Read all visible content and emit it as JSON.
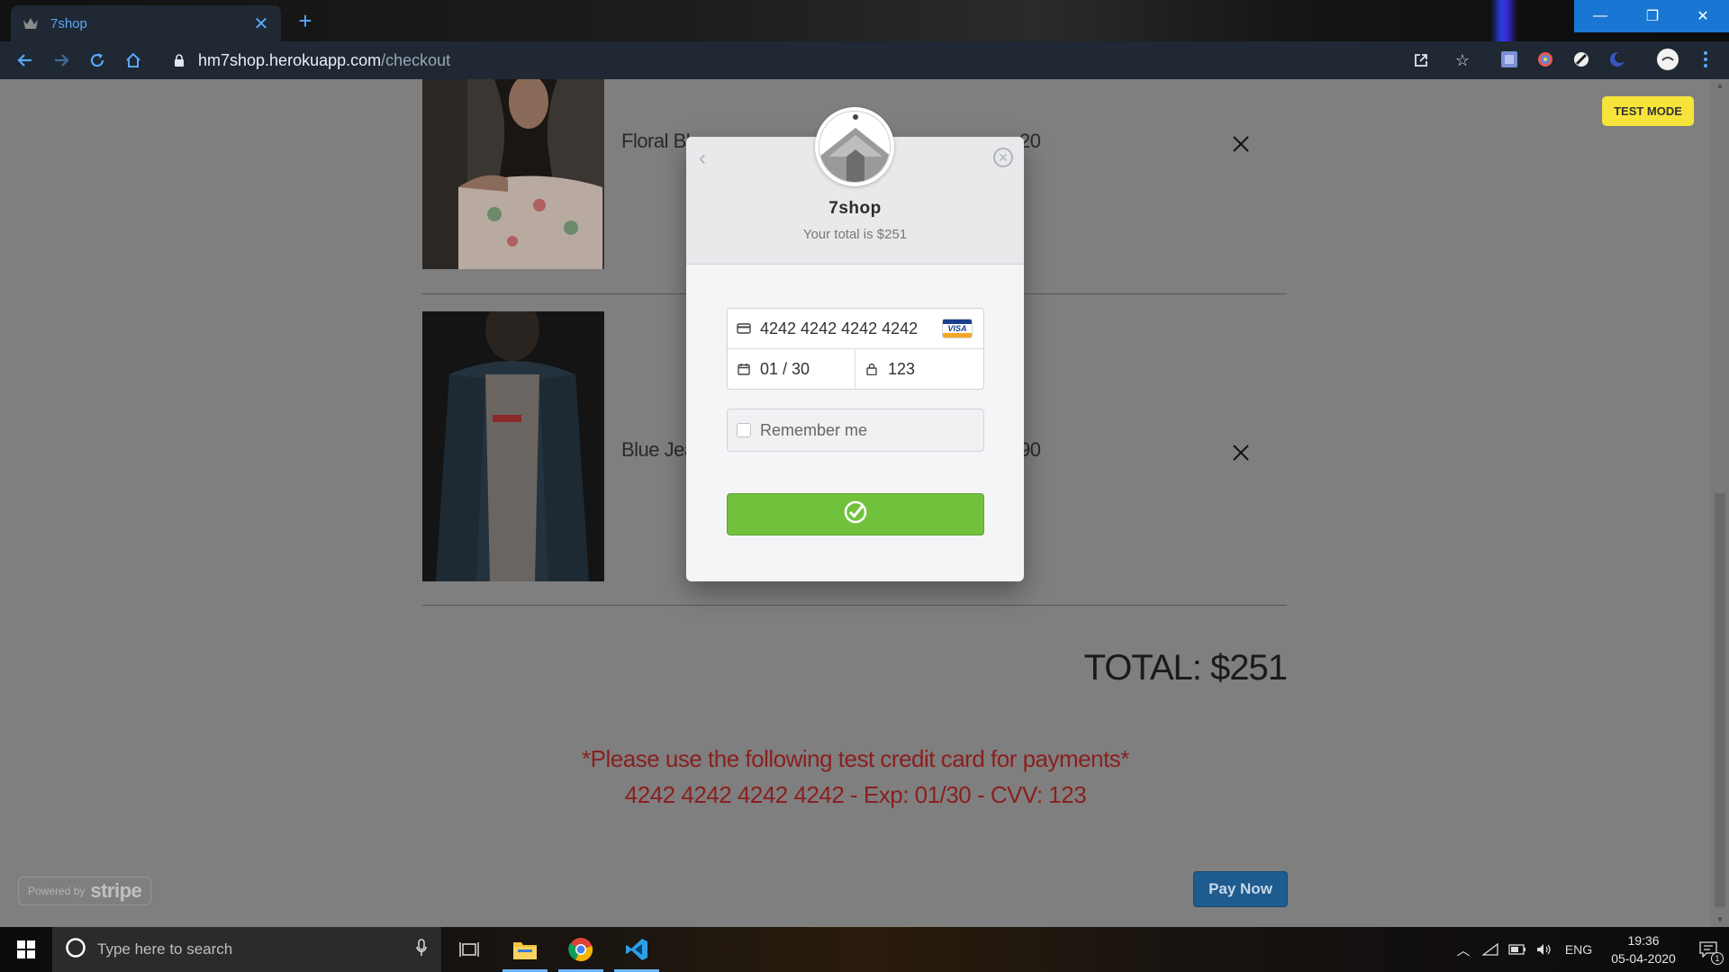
{
  "browser": {
    "tab_title": "7shop",
    "url_host": "hm7shop.herokuapp.com",
    "url_path": "/checkout",
    "window_controls": [
      "minimize",
      "restore",
      "close"
    ]
  },
  "page": {
    "test_mode_label": "TEST MODE",
    "products": [
      {
        "name": "Floral Blo",
        "price": "20"
      },
      {
        "name": "Blue Jear",
        "price": "90"
      }
    ],
    "total": "TOTAL: $251",
    "note_line1": "*Please use the following test credit card for payments*",
    "note_line2": "4242 4242 4242 4242 - Exp: 01/30 - CVV: 123",
    "pay_button": "Pay Now",
    "powered_by": "Powered by",
    "powered_brand": "stripe"
  },
  "checkout_modal": {
    "shop_name": "7shop",
    "total_text": "Your total is $251",
    "card_number": "4242 4242 4242 4242",
    "card_brand": "VISA",
    "expiry": "01 / 30",
    "cvc": "123",
    "remember_label": "Remember me"
  },
  "taskbar": {
    "search_placeholder": "Type here to search",
    "language": "ENG",
    "time": "19:36",
    "date": "05-04-2020",
    "notification_count": "1"
  },
  "colors": {
    "accent_blue": "#5aa7ff",
    "submit_green": "#72c13d",
    "note_red": "#8a1f1f",
    "test_mode_yellow": "#f7e43a"
  }
}
